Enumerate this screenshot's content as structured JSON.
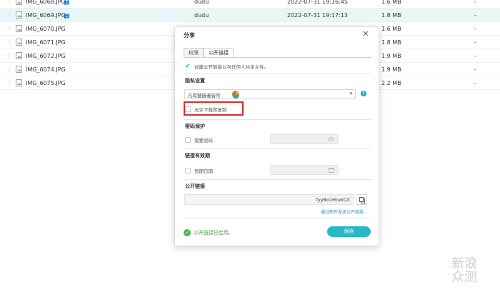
{
  "files": [
    {
      "name": "IMG_6068.JPG",
      "shared": true,
      "owner": "dudu",
      "date": "2022-07-31 19:16:45",
      "size": "1.6 MB",
      "extra": "-"
    },
    {
      "name": "IMG_6069.JPG",
      "shared": true,
      "owner": "dudu",
      "date": "2022-07-31 19:17:13",
      "size": "1.8 MB",
      "extra": "-"
    },
    {
      "name": "IMG_6070.JPG",
      "shared": false,
      "owner": "",
      "date": "",
      "size": "1.6 MB",
      "extra": "-"
    },
    {
      "name": "IMG_6071.JPG",
      "shared": false,
      "owner": "",
      "date": "",
      "size": "1.8 MB",
      "extra": "-"
    },
    {
      "name": "IMG_6072.JPG",
      "shared": false,
      "owner": "",
      "date": "",
      "size": "1.9 MB",
      "extra": "-"
    },
    {
      "name": "IMG_6074.JPG",
      "shared": false,
      "owner": "",
      "date": "",
      "size": "1.9 MB",
      "extra": "-"
    },
    {
      "name": "IMG_6075.JPG",
      "shared": false,
      "owner": "",
      "date": "",
      "size": "2.2 MB",
      "extra": "-"
    }
  ],
  "dialog": {
    "title": "分享",
    "close_icon": "close-icon",
    "tabs": [
      "权限",
      "公开链接"
    ],
    "active_tab": "公开链接",
    "create_link_text": "创建公开链接以与任何人共享文件。",
    "privacy": {
      "title": "隐私设置",
      "selected_option": "凡有链接者皆可",
      "allow_download_label": "允许下载和复制"
    },
    "password": {
      "title": "密码保护",
      "checkbox_label": "需要密码"
    },
    "expiry": {
      "title": "链接有效期",
      "checkbox_label": "到期日期"
    },
    "public_link": {
      "title": "公开链接",
      "link_suffix": "fyyBo1HcwiC/t",
      "email_link": "通过邮件发送公开链接"
    },
    "status_text": "公开链接已启用。",
    "save_label": "保存"
  },
  "watermark": "新浪众测",
  "colors": {
    "accent": "#27b8c8",
    "highlight": "#d32d2d",
    "success": "#4cb54a",
    "selected_row": "#e8f6f8"
  }
}
